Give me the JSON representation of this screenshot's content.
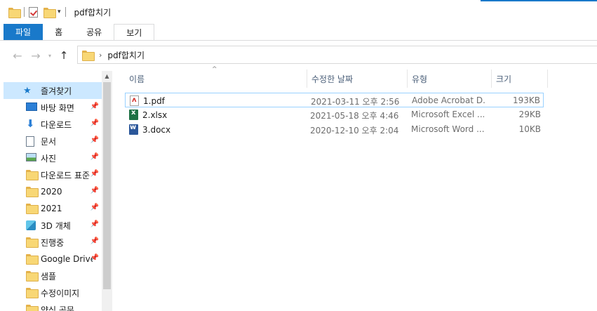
{
  "window": {
    "title": "pdf합치기"
  },
  "ribbon": {
    "tabs": [
      "파일",
      "홈",
      "공유",
      "보기"
    ]
  },
  "address": {
    "path": "pdf합치기"
  },
  "sidebar": {
    "items": [
      {
        "label": "즐겨찾기",
        "icon": "star-icon",
        "pinned": false
      },
      {
        "label": "바탕 화면",
        "icon": "desktop-icon",
        "pinned": true
      },
      {
        "label": "다운로드",
        "icon": "download-icon",
        "pinned": true
      },
      {
        "label": "문서",
        "icon": "document-icon",
        "pinned": true
      },
      {
        "label": "사진",
        "icon": "pictures-icon",
        "pinned": true
      },
      {
        "label": "다운로드 표준",
        "icon": "folder-icon",
        "pinned": true
      },
      {
        "label": "2020",
        "icon": "folder-icon",
        "pinned": true
      },
      {
        "label": "2021",
        "icon": "folder-icon",
        "pinned": true
      },
      {
        "label": "3D 개체",
        "icon": "3d-objects-icon",
        "pinned": true
      },
      {
        "label": "진행중",
        "icon": "folder-icon",
        "pinned": true
      },
      {
        "label": "Google Drive",
        "icon": "folder-icon",
        "pinned": true
      },
      {
        "label": "샘플",
        "icon": "folder-icon",
        "pinned": false
      },
      {
        "label": "수정이미지",
        "icon": "folder-icon",
        "pinned": false
      },
      {
        "label": "양식 공문",
        "icon": "folder-icon",
        "pinned": false
      }
    ]
  },
  "columns": {
    "name": "이름",
    "date": "수정한 날짜",
    "type": "유형",
    "size": "크기"
  },
  "files": [
    {
      "name": "1.pdf",
      "date": "2021-03-11 오후 2:56",
      "type": "Adobe Acrobat D...",
      "size": "193KB",
      "icon": "pdf-file-icon"
    },
    {
      "name": "2.xlsx",
      "date": "2021-05-18 오후 4:46",
      "type": "Microsoft Excel ...",
      "size": "29KB",
      "icon": "excel-file-icon"
    },
    {
      "name": "3.docx",
      "date": "2020-12-10 오후 2:04",
      "type": "Microsoft Word ...",
      "size": "10KB",
      "icon": "word-file-icon"
    }
  ],
  "colors": {
    "accent": "#1979ca",
    "selection": "#cce8ff",
    "selection_border": "#99d1ff"
  }
}
